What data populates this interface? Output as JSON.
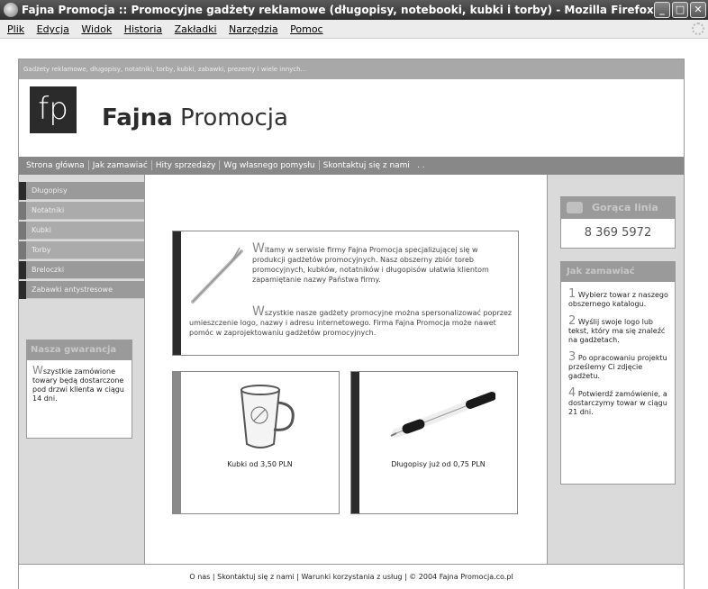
{
  "window": {
    "title": "Fajna Promocja :: Promocyjne gadżety reklamowe (długopisy, notebooki, kubki i torby) - Mozilla Firefox"
  },
  "menu": [
    "Plik",
    "Edycja",
    "Widok",
    "Historia",
    "Zakładki",
    "Narzędzia",
    "Pomoc"
  ],
  "site": {
    "tagline": "Gadżety reklamowe, długopisy, notatniki, torby, kubki, zabawki, prezenty i wiele innych...",
    "logo_letters": "fp",
    "brand_bold": "Fajna",
    "brand_rest": " Promocja"
  },
  "nav": [
    "Strona główna",
    "Jak zamawiać",
    "Hity sprzedaży",
    "Wg własnego pomysłu",
    "Skontaktuj się z nami",
    ". ."
  ],
  "sidebar": {
    "items": [
      {
        "label": "Długopisy"
      },
      {
        "label": "Notatniki"
      },
      {
        "label": "Kubki"
      },
      {
        "label": "Torby"
      },
      {
        "label": "Breloczki"
      },
      {
        "label": "Zabawki antystresowe"
      }
    ],
    "guarantee": {
      "title": "Nasza gwarancja",
      "first_letter": "W",
      "text": "szystkie zamówione towary będą dostarczone pod drzwi klienta w ciągu 14 dni."
    }
  },
  "welcome": {
    "p1_cap": "W",
    "p1": "itamy w serwisie firmy Fajna Promocja specjalizującej się w produkcji gadżetów promocyjnych. Nasz obszerny zbiór toreb promocyjnych, kubków, notatników i długopisów ułatwia klientom zapamiętanie nazwy Państwa firmy.",
    "p2_cap": "W",
    "p2": "szystkie nasze gadżety promocyjne można spersonalizować poprzez umieszczenie logo, nazwy i adresu internetowego. Firma Fajna Promocja może nawet pomóc w zaprojektowaniu gadżetów promocyjnych."
  },
  "products": [
    {
      "caption": "Kubki od 3,50 PLN"
    },
    {
      "caption": "Długopisy już od 0,75 PLN"
    }
  ],
  "hotline": {
    "title": "Gorąca linia",
    "phone": "8 369 5972"
  },
  "how_to_order": {
    "title": "Jak zamawiać",
    "steps": [
      {
        "num": "1",
        "text": "Wybierz towar z naszego obszernego katalogu."
      },
      {
        "num": "2",
        "text": "Wyślij swoje logo lub tekst, który ma się znaleźć na gadżetach."
      },
      {
        "num": "3",
        "text": "Po opracowaniu projektu prześlemy Ci zdjęcie gadżetu."
      },
      {
        "num": "4",
        "text": "Potwierdź zamówienie, a dostarczymy towar w ciągu 21 dni."
      }
    ]
  },
  "footer": "O nas | Skontaktuj się z nami | Warunki korzystania z usług | © 2004 Fajna Promocja.co.pl"
}
